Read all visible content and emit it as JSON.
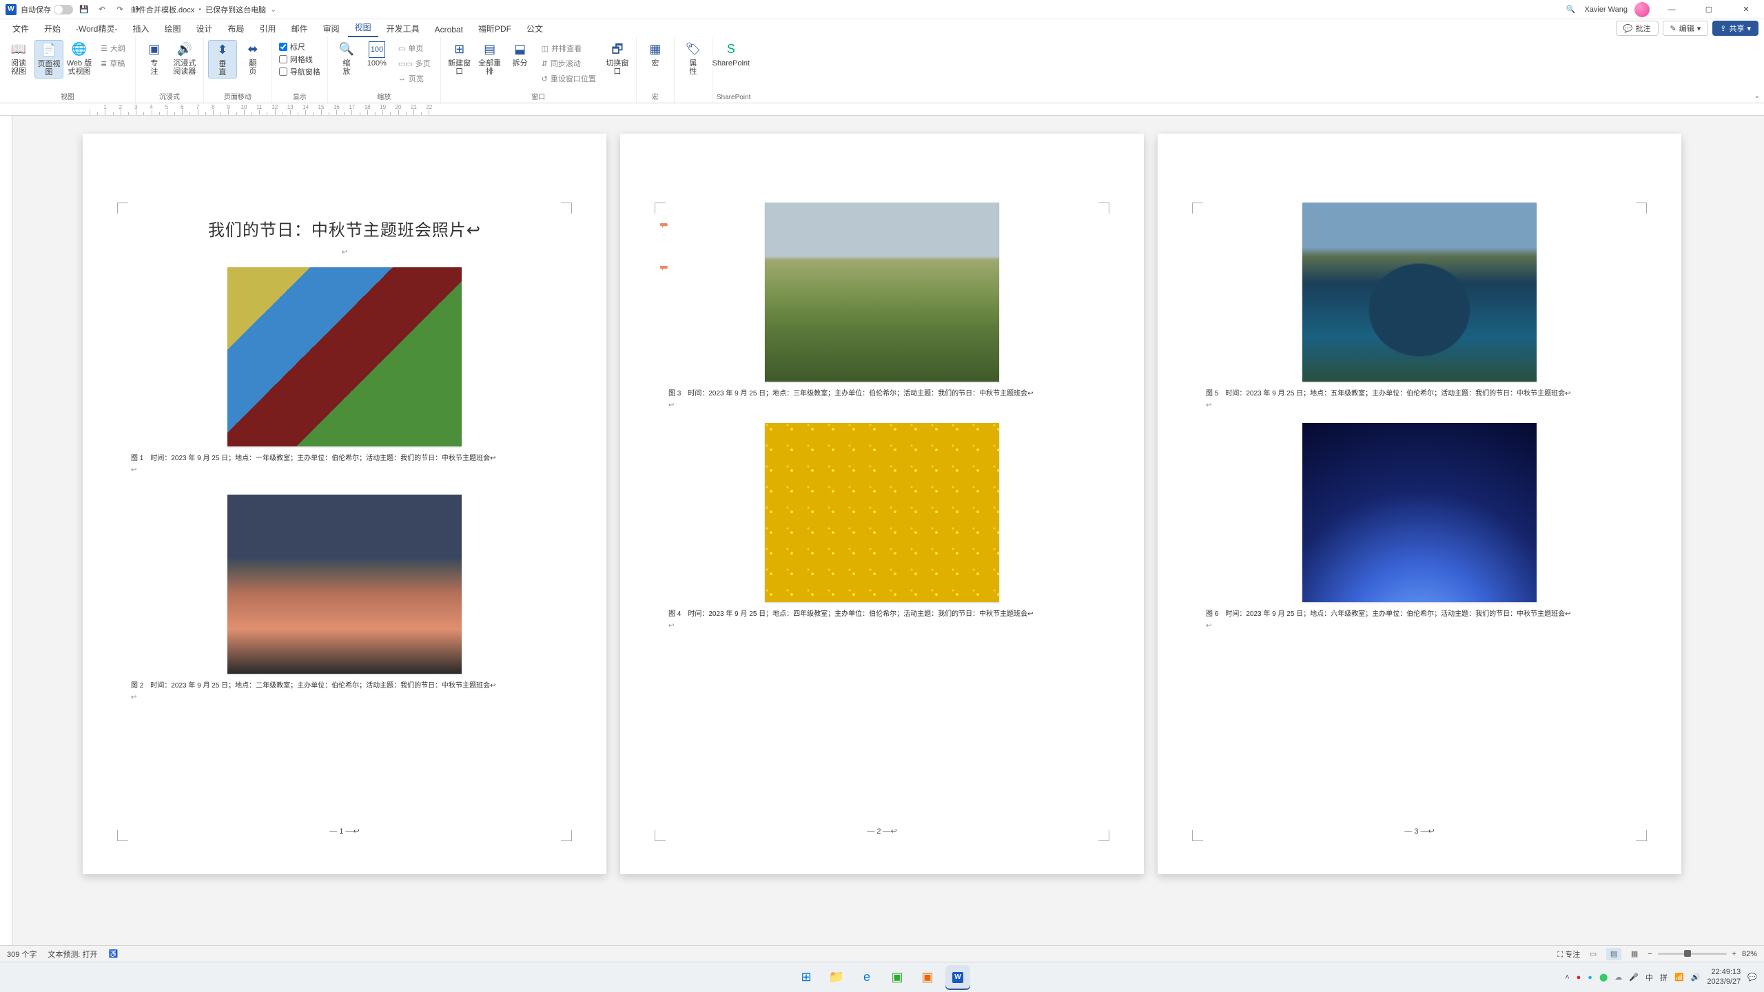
{
  "title_bar": {
    "autosave_label": "自动保存",
    "doc_name": "邮件合并模板.docx",
    "save_state": "已保存到这台电脑",
    "user_name": "Xavier Wang"
  },
  "menu": {
    "items": [
      "文件",
      "开始",
      "-Word精灵-",
      "插入",
      "绘图",
      "设计",
      "布局",
      "引用",
      "邮件",
      "审阅",
      "视图",
      "开发工具",
      "Acrobat",
      "福昕PDF",
      "公文"
    ],
    "active_index": 10,
    "comments": "批注",
    "edit": "编辑",
    "share": "共享"
  },
  "ribbon": {
    "groups": {
      "views": {
        "label": "视图",
        "buttons": [
          "阅读\n视图",
          "页面视图",
          "Web 版式视图"
        ],
        "col2": [
          "大纲",
          "草稿"
        ]
      },
      "immersive": {
        "label": "沉浸式",
        "buttons": [
          "专\n注",
          "沉浸式\n阅读器"
        ]
      },
      "page_move": {
        "label": "页面移动",
        "buttons": [
          "垂\n直",
          "翻\n页"
        ]
      },
      "show": {
        "label": "显示",
        "checks": [
          [
            "标尺",
            true
          ],
          [
            "网格线",
            false
          ],
          [
            "导航窗格",
            false
          ]
        ]
      },
      "zoom": {
        "label": "缩放",
        "buttons": [
          "缩\n放",
          "100%"
        ],
        "col2": [
          "单页",
          "多页",
          "页宽"
        ]
      },
      "window": {
        "label": "窗口",
        "buttons": [
          "新建窗口",
          "全部重排",
          "拆分"
        ],
        "links": [
          "并排查看",
          "同步滚动",
          "重设窗口位置"
        ],
        "switch": "切换窗口"
      },
      "macros": {
        "label": "宏",
        "button": "宏"
      },
      "prop": {
        "label": "",
        "button": "属\n性"
      },
      "sp": {
        "label": "SharePoint"
      }
    }
  },
  "chart_data": {
    "type": "table",
    "title": "我们的节日：中秋节主题班会照片",
    "columns": [
      "图",
      "教室",
      "时间",
      "地点",
      "主办单位",
      "活动主题"
    ],
    "rows": [
      [
        "图 1",
        "一年级教室",
        "2023 年 9 月 25 日",
        "一年级教室",
        "伯伦希尔",
        "我们的节日：中秋节主题班会"
      ],
      [
        "图 2",
        "二年级教室",
        "2023 年 9 月 25 日",
        "二年级教室",
        "伯伦希尔",
        "我们的节日：中秋节主题班会"
      ],
      [
        "图 3",
        "三年级教室",
        "2023 年 9 月 25 日",
        "三年级教室",
        "伯伦希尔",
        "我们的节日：中秋节主题班会"
      ],
      [
        "图 4",
        "四年级教室",
        "2023 年 9 月 25 日",
        "四年级教室",
        "伯伦希尔",
        "我们的节日：中秋节主题班会"
      ],
      [
        "图 5",
        "五年级教室",
        "2023 年 9 月 25 日",
        "五年级教室",
        "伯伦希尔",
        "我们的节日：中秋节主题班会"
      ],
      [
        "图 6",
        "六年级教室",
        "2023 年 9 月 25 日",
        "六年级教室",
        "伯伦希尔",
        "我们的节日：中秋节主题班会"
      ]
    ]
  },
  "document": {
    "title": "我们的节日：中秋节主题班会照片↩",
    "captions": [
      "图 1　时间：2023 年 9 月 25 日；地点：一年级教室；主办单位：伯伦希尔；活动主题：我们的节日：中秋节主题班会↩",
      "图 2　时间：2023 年 9 月 25 日；地点：二年级教室；主办单位：伯伦希尔；活动主题：我们的节日：中秋节主题班会↩",
      "图 3　时间：2023 年 9 月 25 日；地点：三年级教室；主办单位：伯伦希尔；活动主题：我们的节日：中秋节主题班会↩",
      "图 4　时间：2023 年 9 月 25 日；地点：四年级教室；主办单位：伯伦希尔；活动主题：我们的节日：中秋节主题班会↩",
      "图 5　时间：2023 年 9 月 25 日；地点：五年级教室；主办单位：伯伦希尔；活动主题：我们的节日：中秋节主题班会↩",
      "图 6　时间：2023 年 9 月 25 日；地点：六年级教室；主办单位：伯伦希尔；活动主题：我们的节日：中秋节主题班会↩"
    ],
    "page_numbers": [
      "—  1  —↩",
      "—  2  —↩",
      "—  3  —↩"
    ]
  },
  "status": {
    "word_count": "309 个字",
    "proof": "文本预测: 打开",
    "focus": "专注",
    "zoom": "82%"
  },
  "tray": {
    "ime1": "中",
    "ime2": "拼",
    "time": "22:49:13",
    "date": "2023/9/27"
  }
}
